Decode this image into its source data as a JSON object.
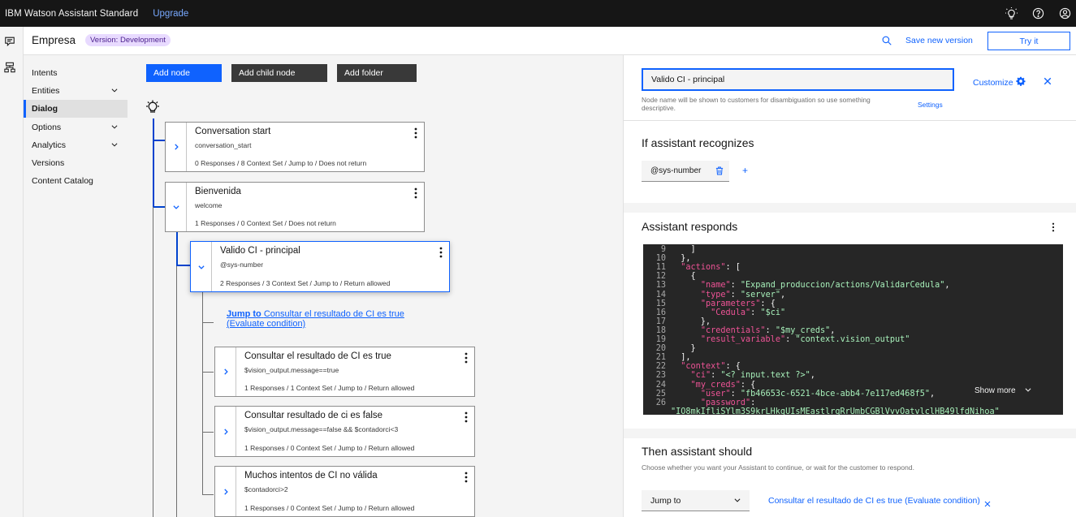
{
  "topbar": {
    "brand_ibm": "IBM",
    "brand_product": "Watson Assistant",
    "brand_plan": "Standard",
    "upgrade": "Upgrade",
    "icons": [
      "lightbulb-icon",
      "help-icon",
      "user-avatar-icon"
    ]
  },
  "rail": {
    "icons": [
      "chat-icon",
      "skills-icon"
    ]
  },
  "subheader": {
    "workspace": "Empresa",
    "version_tag": "Version: Development",
    "save_new_version": "Save new version",
    "try_it": "Try it"
  },
  "nav": {
    "items": [
      {
        "label": "Intents",
        "expandable": false
      },
      {
        "label": "Entities",
        "expandable": true
      },
      {
        "label": "Dialog",
        "expandable": false,
        "active": true
      },
      {
        "label": "Options",
        "expandable": true
      },
      {
        "label": "Analytics",
        "expandable": true
      },
      {
        "label": "Versions",
        "expandable": false
      },
      {
        "label": "Content Catalog",
        "expandable": false
      }
    ]
  },
  "toolbar": {
    "add_node": "Add node",
    "add_child_node": "Add child node",
    "add_folder": "Add folder"
  },
  "tree": {
    "nodes": [
      {
        "title": "Conversation start",
        "condition": "conversation_start",
        "summary": "0 Responses / 8 Context Set / Jump to / Does not return"
      },
      {
        "title": "Bienvenida",
        "condition": "welcome",
        "summary": "1 Responses / 0 Context Set / Does not return"
      },
      {
        "title": "Valido CI - principal",
        "condition": "@sys-number",
        "summary": "2 Responses / 3 Context Set / Jump to / Return allowed"
      },
      {
        "title": "Consultar el resultado de CI es true",
        "condition": "$vision_output.message==true",
        "summary": "1 Responses / 1 Context Set / Jump to / Return allowed"
      },
      {
        "title": "Consultar resultado de ci es false",
        "condition": "$vision_output.message==false && $contadorci<3",
        "summary": "1 Responses / 0 Context Set / Jump to / Return allowed"
      },
      {
        "title": "Muchos intentos de CI no válida",
        "condition": "$contadorci>2",
        "summary": "1 Responses / 0 Context Set / Jump to / Return allowed"
      }
    ],
    "jump": {
      "prefix": "Jump to",
      "target": "Consultar el resultado de CI es true",
      "mode": "(Evaluate condition)"
    }
  },
  "panel": {
    "node_name": "Valido CI - principal",
    "customize": "Customize",
    "help_text": "Node name will be shown to customers for disambiguation so use something descriptive.",
    "settings": "Settings",
    "recognizes_title": "If assistant recognizes",
    "condition_chip": "@sys-number",
    "plus": "+",
    "responds_title": "Assistant responds",
    "code_lines": [
      {
        "n": "9",
        "t": "    ]"
      },
      {
        "n": "10",
        "t": "  },"
      },
      {
        "n": "11",
        "t": "  \"actions\": ["
      },
      {
        "n": "12",
        "t": "    {"
      },
      {
        "n": "13",
        "t": "      \"name\": \"Expand_produccion/actions/ValidarCedula\","
      },
      {
        "n": "14",
        "t": "      \"type\": \"server\","
      },
      {
        "n": "15",
        "t": "      \"parameters\": {"
      },
      {
        "n": "16",
        "t": "        \"Cedula\": \"$ci\""
      },
      {
        "n": "17",
        "t": "      },"
      },
      {
        "n": "18",
        "t": "      \"credentials\": \"$my_creds\","
      },
      {
        "n": "19",
        "t": "      \"result_variable\": \"context.vision_output\""
      },
      {
        "n": "20",
        "t": "    }"
      },
      {
        "n": "21",
        "t": "  ],"
      },
      {
        "n": "22",
        "t": "  \"context\": {"
      },
      {
        "n": "23",
        "t": "    \"ci\": \"<? input.text ?>\","
      },
      {
        "n": "24",
        "t": "    \"my_creds\": {"
      },
      {
        "n": "25",
        "t": "      \"user\": \"fb46653c-6521-4bce-abb4-7e117ed468f5\","
      },
      {
        "n": "26",
        "t": "      \"password\":"
      },
      {
        "n": "",
        "t": "\"IO8mkIfliSYlm3S9krLHkqUIsMEastlrqRrUmbCGBlVvvOatvlclHB49lfdNihoa\""
      }
    ],
    "show_more": "Show more",
    "then_title": "Then assistant should",
    "then_desc": "Choose whether you want your Assistant to continue, or wait for the customer to respond.",
    "then_action": "Jump to",
    "jump_target": "Consultar el resultado de CI es true (Evaluate condition)"
  },
  "colors": {
    "accent": "#0f62fe",
    "topbar_bg": "#161616",
    "version_tag_bg": "#e8daff",
    "code_bg": "#262626"
  }
}
